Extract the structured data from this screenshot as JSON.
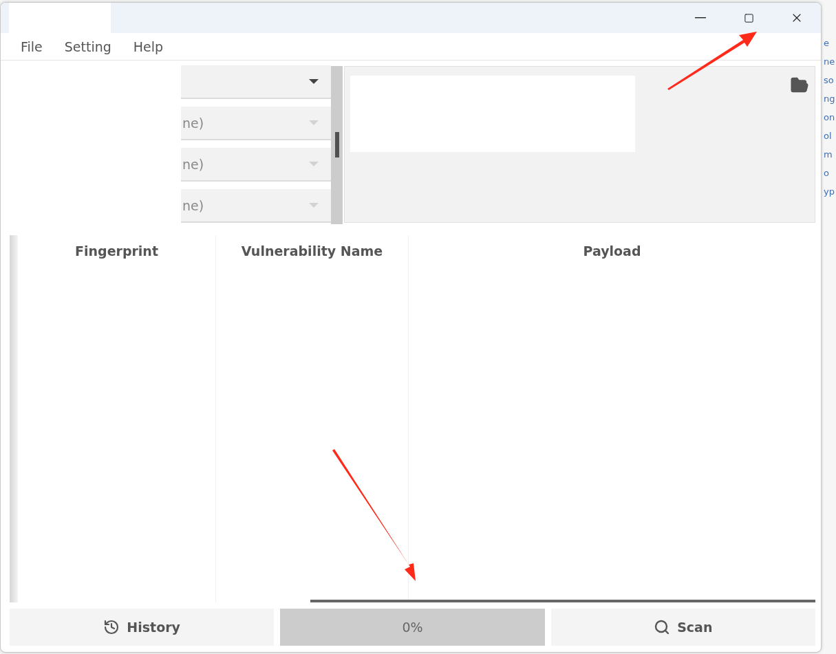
{
  "menu": [
    {
      "label": "File"
    },
    {
      "label": "Setting"
    },
    {
      "label": "Help"
    }
  ],
  "selectors": [
    {
      "disabled": false
    },
    {
      "value": "ne)",
      "disabled": true
    },
    {
      "value": "ne)",
      "disabled": true
    },
    {
      "value": "ne)",
      "disabled": true
    }
  ],
  "table": {
    "columns": [
      "Fingerprint",
      "Vulnerability Name",
      "Payload"
    ]
  },
  "buttons": [
    {
      "kind": "history",
      "label": "History"
    },
    {
      "kind": "progress",
      "label": "0%",
      "level": 0
    },
    {
      "kind": "scan",
      "label": "Scan"
    }
  ],
  "background_fragments": [
    "e",
    "ne",
    "so",
    "ng",
    "on",
    "ol",
    "m",
    "o",
    "yp"
  ]
}
